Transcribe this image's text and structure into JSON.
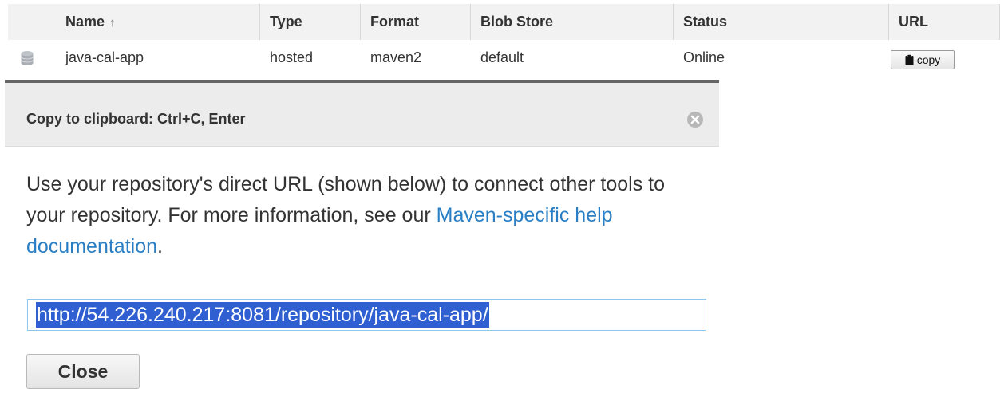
{
  "table": {
    "columns": [
      {
        "label": "Name",
        "sort_icon": "arrow-up-icon"
      },
      {
        "label": "Type"
      },
      {
        "label": "Format"
      },
      {
        "label": "Blob Store"
      },
      {
        "label": "Status"
      },
      {
        "label": "URL"
      }
    ],
    "rows": [
      {
        "icon": "database-icon",
        "name": "java-cal-app",
        "type": "hosted",
        "format": "maven2",
        "blob_store": "default",
        "status": "Online",
        "url_button_label": "copy",
        "url_button_icon": "clipboard-icon"
      }
    ]
  },
  "dialog": {
    "title": "Copy to clipboard: Ctrl+C, Enter",
    "close_icon": "close-circle-icon",
    "message_text": "Use your repository's direct URL (shown below) to connect other tools to your repository. For more information, see our ",
    "message_link": "Maven-specific help documentation",
    "message_end": ".",
    "url_value": "http://54.226.240.217:8081/repository/java-cal-app/",
    "close_button_label": "Close"
  },
  "colors": {
    "link": "#2a7fc4",
    "selection": "#2f5fd0",
    "header_bg": "#ececec",
    "input_border": "#8ec7ee"
  }
}
